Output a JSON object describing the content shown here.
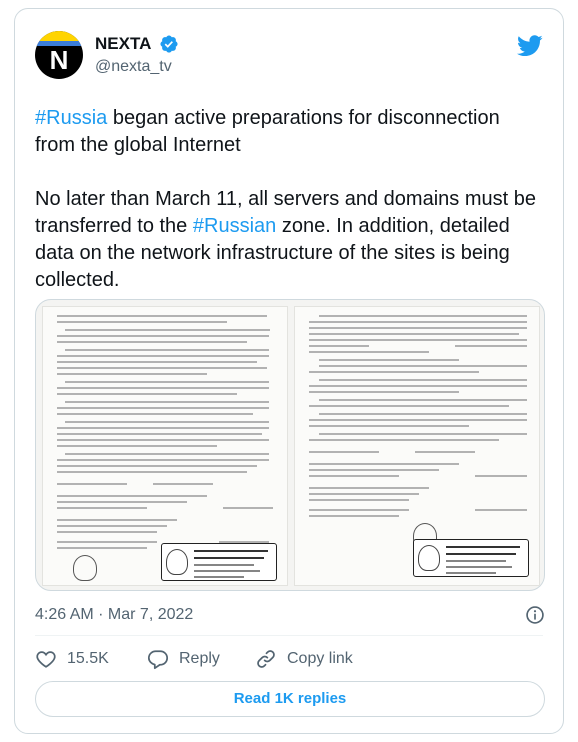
{
  "account": {
    "display_name": "NEXTA",
    "handle": "@nexta_tv",
    "avatar_letter": "N",
    "verified": true
  },
  "tweet": {
    "p1": [
      {
        "text": "#Russia",
        "hashtag": true
      },
      {
        "text": " began active preparations for disconnection from the global Internet",
        "hashtag": false
      }
    ],
    "p2": [
      {
        "text": "No later than March 11, all servers and domains must be transferred to the ",
        "hashtag": false
      },
      {
        "text": "#Russian",
        "hashtag": true
      },
      {
        "text": " zone. In addition, detailed data on the network infrastructure of the sites is being collected.",
        "hashtag": false
      }
    ]
  },
  "media": {
    "type": "document-scan",
    "pages": 2
  },
  "meta": {
    "timestamp": "4:26 AM · Mar 7, 2022"
  },
  "actions": {
    "like_count": "15.5K",
    "reply_label": "Reply",
    "copy_link_label": "Copy link"
  },
  "read_replies_label": "Read 1K replies",
  "colors": {
    "accent": "#1d9bf0",
    "text": "#0f1419",
    "muted": "#536471",
    "border": "#cfd9de"
  },
  "icons": [
    "verified-badge-icon",
    "twitter-bird-icon",
    "info-icon",
    "heart-icon",
    "reply-bubble-icon",
    "link-icon"
  ]
}
